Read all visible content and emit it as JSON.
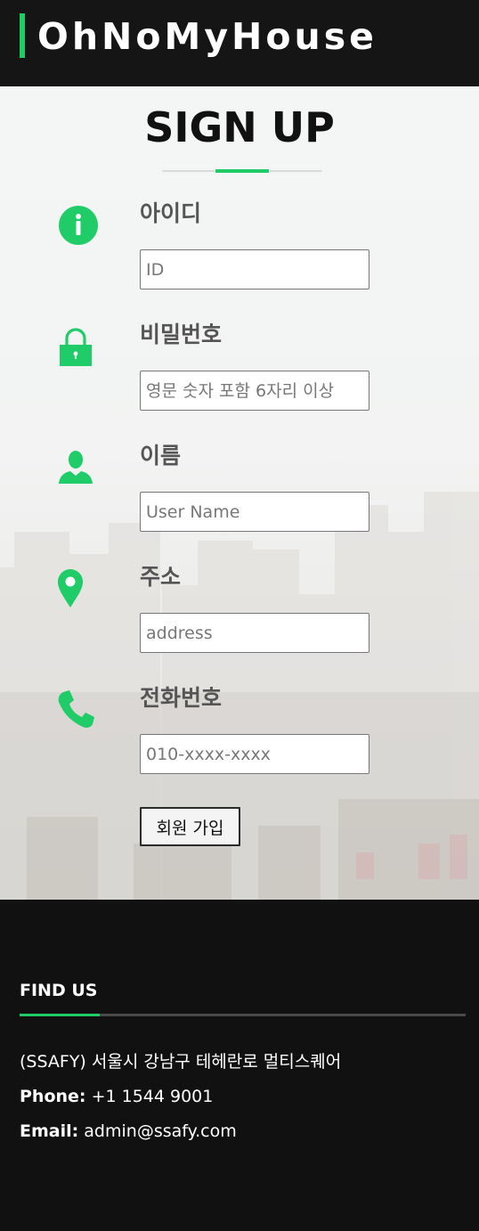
{
  "header": {
    "brand": "OhNoMyHouse"
  },
  "signup": {
    "title": "SIGN UP",
    "fields": [
      {
        "label": "아이디",
        "placeholder": "ID",
        "icon": "info-icon"
      },
      {
        "label": "비밀번호",
        "placeholder": "영문 숫자 포함 6자리 이상",
        "icon": "lock-icon"
      },
      {
        "label": "이름",
        "placeholder": "User Name",
        "icon": "user-icon"
      },
      {
        "label": "주소",
        "placeholder": "address",
        "icon": "location-pin-icon"
      },
      {
        "label": "전화번호",
        "placeholder": "010-xxxx-xxxx",
        "icon": "phone-icon"
      }
    ],
    "submit_label": "회원 가입"
  },
  "footer": {
    "title": "FIND US",
    "address": "(SSAFY) 서울시 강남구 테헤란로 멀티스퀘어",
    "phone_label": "Phone:",
    "phone": "+1 1544 9001",
    "email_label": "Email:",
    "email": "admin@ssafy.com"
  },
  "colors": {
    "accent": "#1fcc68",
    "header_bg": "#151515",
    "footer_bg": "#111111",
    "label": "#555555"
  }
}
